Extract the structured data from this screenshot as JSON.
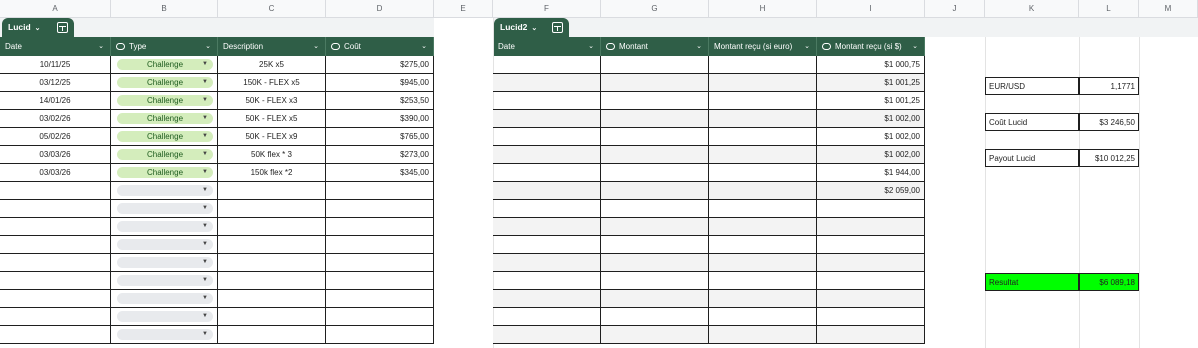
{
  "columns": [
    "A",
    "B",
    "C",
    "D",
    "E",
    "F",
    "G",
    "H",
    "I",
    "J",
    "K",
    "L",
    "M"
  ],
  "table1": {
    "name": "Lucid",
    "headers": [
      "Date",
      "Type",
      "Description",
      "Coût"
    ],
    "rows": [
      {
        "date": "10/11/25",
        "type": "Challenge",
        "desc": "25K  x5",
        "cost": "$275,00"
      },
      {
        "date": "03/12/25",
        "type": "Challenge",
        "desc": "150K - FLEX x5",
        "cost": "$945,00"
      },
      {
        "date": "14/01/26",
        "type": "Challenge",
        "desc": "50K - FLEX x3",
        "cost": "$253,50"
      },
      {
        "date": "03/02/26",
        "type": "Challenge",
        "desc": "50K - FLEX x5",
        "cost": "$390,00"
      },
      {
        "date": "05/02/26",
        "type": "Challenge",
        "desc": "50K - FLEX x9",
        "cost": "$765,00"
      },
      {
        "date": "03/03/26",
        "type": "Challenge",
        "desc": "50K flex * 3",
        "cost": "$273,00"
      },
      {
        "date": "03/03/26",
        "type": "Challenge",
        "desc": "150k flex *2",
        "cost": "$345,00"
      }
    ]
  },
  "table2": {
    "name": "Lucid2",
    "headers": [
      "Date",
      "Montant",
      "Montant reçu (si euro)",
      "Montant reçu (si $)"
    ],
    "received_usd": [
      "$1 000,75",
      "$1 001,25",
      "$1 001,25",
      "$1 002,00",
      "$1 002,00",
      "$1 002,00",
      "$1 944,00",
      "$2 059,00"
    ]
  },
  "summary": {
    "eurusd_label": "EUR/USD",
    "eurusd_value": "1,1771",
    "cout_label": "Coût Lucid",
    "cout_value": "$3 246,50",
    "payout_label": "Payout Lucid",
    "payout_value": "$10 012,25",
    "result_label": "Resultat",
    "result_value": "$6 089,18",
    "result_color": "#00ff00"
  }
}
